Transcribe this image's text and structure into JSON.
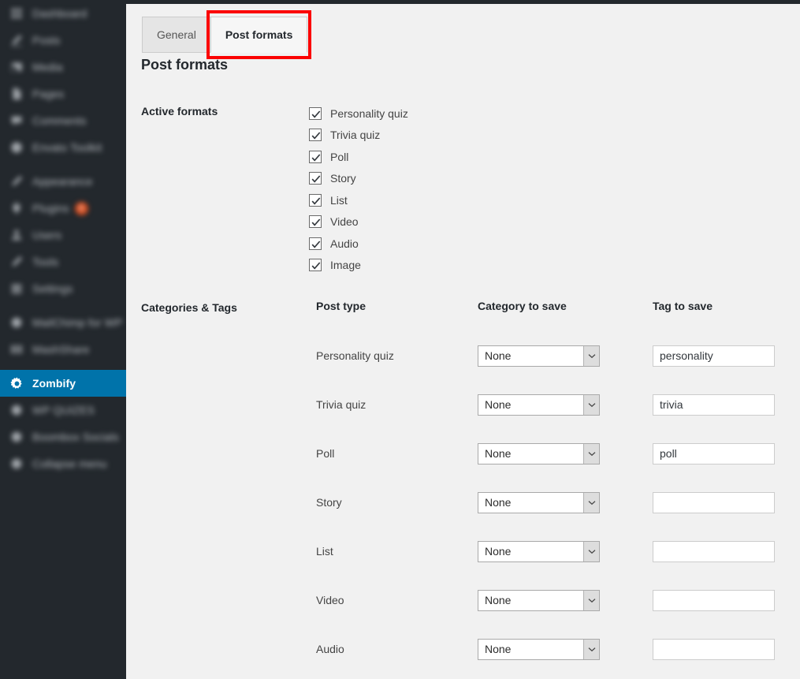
{
  "sidebar": {
    "items": [
      {
        "label": "Dashboard",
        "icon": "dashboard-icon",
        "obscured": true,
        "active": false
      },
      {
        "label": "Posts",
        "icon": "pin-icon",
        "obscured": true,
        "active": false
      },
      {
        "label": "Media",
        "icon": "media-icon",
        "obscured": true,
        "active": false
      },
      {
        "label": "Pages",
        "icon": "page-icon",
        "obscured": true,
        "active": false
      },
      {
        "label": "Comments",
        "icon": "comment-icon",
        "obscured": true,
        "active": false
      },
      {
        "label": "Envato Toolkit",
        "icon": "envato-icon",
        "obscured": true,
        "active": false
      },
      {
        "label": "Appearance",
        "icon": "brush-icon",
        "obscured": true,
        "active": false
      },
      {
        "label": "Plugins",
        "icon": "plug-icon",
        "obscured": true,
        "active": false,
        "bubble": "6"
      },
      {
        "label": "Users",
        "icon": "users-icon",
        "obscured": true,
        "active": false
      },
      {
        "label": "Tools",
        "icon": "tools-icon",
        "obscured": true,
        "active": false
      },
      {
        "label": "Settings",
        "icon": "settings-icon",
        "obscured": true,
        "active": false
      },
      {
        "label": "MailChimp for WP",
        "icon": "mailchimp-icon",
        "obscured": true,
        "active": false
      },
      {
        "label": "MashShare",
        "icon": "mashshare-icon",
        "obscured": true,
        "active": false
      },
      {
        "label": "Zombify",
        "icon": "gear-icon",
        "obscured": false,
        "active": true
      },
      {
        "label": "WP QUIZES",
        "icon": "quiz-icon",
        "obscured": true,
        "active": false
      },
      {
        "label": "Boombox Socials",
        "icon": "socials-icon",
        "obscured": true,
        "active": false
      },
      {
        "label": "Collapse menu",
        "icon": "collapse-icon",
        "obscured": true,
        "active": false
      }
    ]
  },
  "tabs": [
    {
      "label": "General",
      "active": false,
      "highlighted": false
    },
    {
      "label": "Post formats",
      "active": true,
      "highlighted": true
    }
  ],
  "page": {
    "title": "Post formats",
    "active_formats_label": "Active formats",
    "categories_tags_label": "Categories & Tags"
  },
  "active_formats": [
    {
      "label": "Personality quiz",
      "checked": true
    },
    {
      "label": "Trivia quiz",
      "checked": true
    },
    {
      "label": "Poll",
      "checked": true
    },
    {
      "label": "Story",
      "checked": true
    },
    {
      "label": "List",
      "checked": true
    },
    {
      "label": "Video",
      "checked": true
    },
    {
      "label": "Audio",
      "checked": true
    },
    {
      "label": "Image",
      "checked": true
    }
  ],
  "categories_table": {
    "headers": [
      "Post type",
      "Category to save",
      "Tag to save"
    ],
    "rows": [
      {
        "post_type": "Personality quiz",
        "category": "None",
        "tag": "personality"
      },
      {
        "post_type": "Trivia quiz",
        "category": "None",
        "tag": "trivia"
      },
      {
        "post_type": "Poll",
        "category": "None",
        "tag": "poll"
      },
      {
        "post_type": "Story",
        "category": "None",
        "tag": ""
      },
      {
        "post_type": "List",
        "category": "None",
        "tag": ""
      },
      {
        "post_type": "Video",
        "category": "None",
        "tag": ""
      },
      {
        "post_type": "Audio",
        "category": "None",
        "tag": ""
      }
    ]
  },
  "colors": {
    "sidebar_bg": "#23282d",
    "active_menu_bg": "#0073aa",
    "highlight_red": "#fb0000",
    "content_bg": "#f1f1f1",
    "bubble_orange": "#d54e21"
  }
}
